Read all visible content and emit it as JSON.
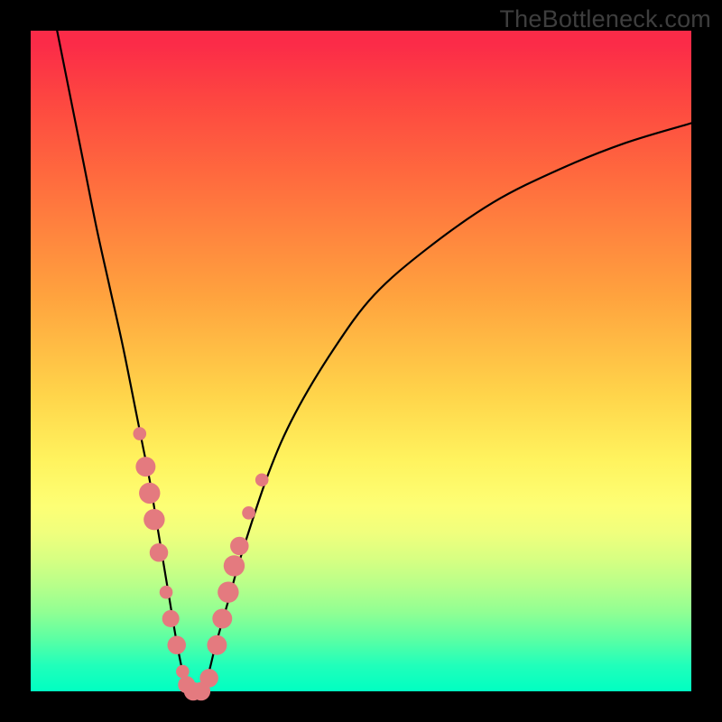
{
  "watermark": "TheBottleneck.com",
  "colors": {
    "frame": "#000000",
    "curve": "#000000",
    "marker_fill": "#e47a7f",
    "marker_stroke": "#d65e64",
    "gradient_top": "#fb2b48",
    "gradient_bottom": "#00ffc2"
  },
  "chart_data": {
    "type": "line",
    "title": "",
    "xlabel": "",
    "ylabel": "",
    "xlim": [
      0,
      100
    ],
    "ylim": [
      0,
      100
    ],
    "grid": false,
    "legend": false,
    "series": [
      {
        "name": "bottleneck-curve",
        "x": [
          4,
          6,
          8,
          10,
          12,
          14,
          16,
          17,
          18,
          19,
          20,
          21,
          22,
          23,
          24,
          25,
          26,
          27,
          28,
          30,
          32,
          36,
          40,
          46,
          52,
          60,
          70,
          80,
          90,
          100
        ],
        "y": [
          100,
          90,
          80,
          70,
          61,
          52,
          42,
          37,
          32,
          26,
          20,
          14,
          8,
          3,
          0,
          0,
          0,
          3,
          7,
          14,
          21,
          33,
          42,
          52,
          60,
          67,
          74,
          79,
          83,
          86
        ]
      }
    ],
    "markers": [
      {
        "x": 16.5,
        "y": 39,
        "r": 1.0
      },
      {
        "x": 17.4,
        "y": 34,
        "r": 1.5
      },
      {
        "x": 18.0,
        "y": 30,
        "r": 1.6
      },
      {
        "x": 18.7,
        "y": 26,
        "r": 1.6
      },
      {
        "x": 19.4,
        "y": 21,
        "r": 1.4
      },
      {
        "x": 20.5,
        "y": 15,
        "r": 1.0
      },
      {
        "x": 21.2,
        "y": 11,
        "r": 1.3
      },
      {
        "x": 22.1,
        "y": 7,
        "r": 1.4
      },
      {
        "x": 23.0,
        "y": 3,
        "r": 1.0
      },
      {
        "x": 23.6,
        "y": 1,
        "r": 1.3
      },
      {
        "x": 24.6,
        "y": 0,
        "r": 1.4
      },
      {
        "x": 25.8,
        "y": 0,
        "r": 1.4
      },
      {
        "x": 27.0,
        "y": 2,
        "r": 1.4
      },
      {
        "x": 28.2,
        "y": 7,
        "r": 1.5
      },
      {
        "x": 29.0,
        "y": 11,
        "r": 1.5
      },
      {
        "x": 29.9,
        "y": 15,
        "r": 1.6
      },
      {
        "x": 30.8,
        "y": 19,
        "r": 1.6
      },
      {
        "x": 31.6,
        "y": 22,
        "r": 1.4
      },
      {
        "x": 33.0,
        "y": 27,
        "r": 1.0
      },
      {
        "x": 35.0,
        "y": 32,
        "r": 1.0
      }
    ]
  }
}
